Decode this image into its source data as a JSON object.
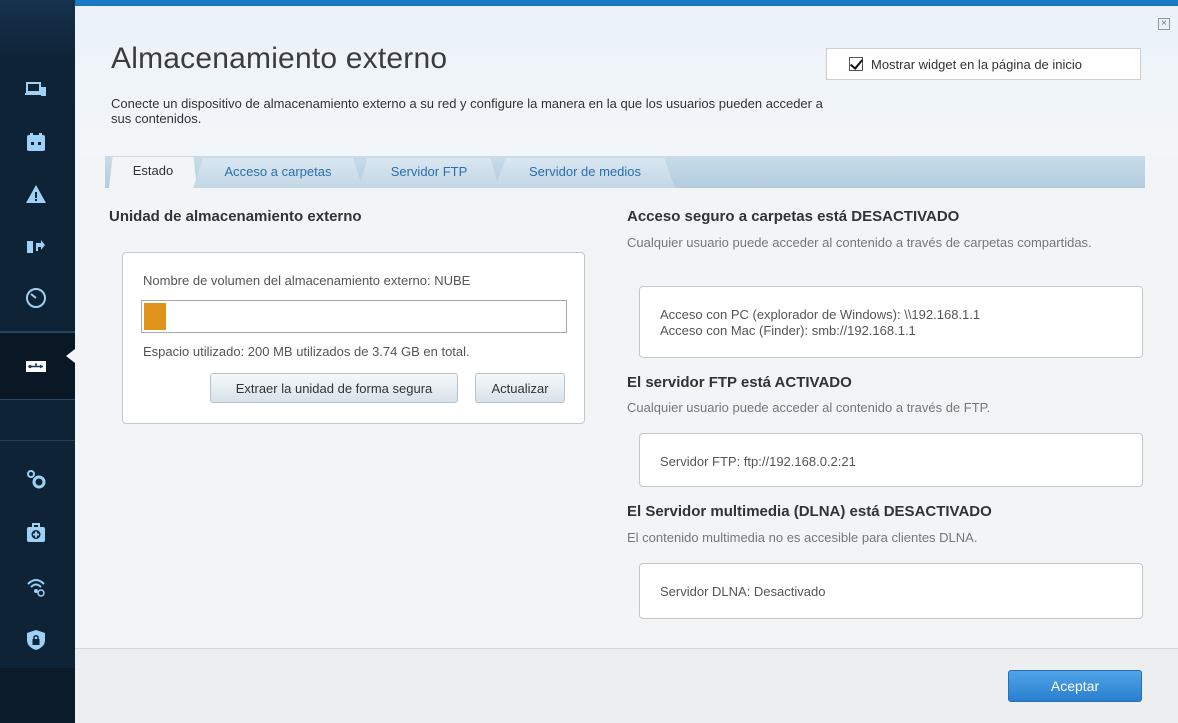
{
  "window": {
    "close_glyph": "×"
  },
  "header": {
    "title": "Almacenamiento externo",
    "description": "Conecte un dispositivo de almacenamiento externo a su red y configure la manera en la que los usuarios pueden acceder a sus contenidos.",
    "widget_checkbox_label": "Mostrar widget en la página de inicio",
    "widget_checked": true
  },
  "tabs": [
    {
      "label": "Estado",
      "active": true
    },
    {
      "label": "Acceso a carpetas",
      "active": false
    },
    {
      "label": "Servidor FTP",
      "active": false
    },
    {
      "label": "Servidor de medios",
      "active": false
    }
  ],
  "left_panel": {
    "section_title": "Unidad de almacenamiento externo",
    "volume_label": "Nombre de volumen del almacenamiento externo: NUBE",
    "usage_fraction": 0.052,
    "usage_color": "#e0931a",
    "used_label": "Espacio utilizado: 200 MB utilizados de 3.74 GB en total.",
    "eject_button": "Extraer la unidad de forma segura",
    "refresh_button": "Actualizar"
  },
  "right_panel": {
    "folder_access": {
      "title": "Acceso seguro a carpetas está DESACTIVADO",
      "subtitle": "Cualquier usuario puede acceder al contenido a través de carpetas compartidas.",
      "line1": "Acceso con PC (explorador de Windows): \\\\192.168.1.1",
      "line2": "Acceso con Mac (Finder): smb://192.168.1.1"
    },
    "ftp": {
      "title": "El servidor FTP está ACTIVADO",
      "subtitle": "Cualquier usuario puede acceder al contenido a través de FTP.",
      "line1": "Servidor FTP: ftp://192.168.0.2:21"
    },
    "dlna": {
      "title": "El Servidor multimedia (DLNA) está DESACTIVADO",
      "subtitle": "El contenido multimedia no es accesible para clientes DLNA.",
      "line1": "Servidor DLNA: Desactivado"
    }
  },
  "footer": {
    "ok_button": "Aceptar"
  },
  "sidebar": {
    "icons": [
      "devices-icon",
      "parental-controls-icon",
      "guest-access-icon",
      "media-prioritization-icon",
      "speed-test-icon",
      "usb-storage-icon",
      "connectivity-settings-icon",
      "troubleshooting-icon",
      "wireless-icon",
      "security-icon"
    ],
    "active": "usb-storage-icon"
  },
  "colors": {
    "accent": "#1b78c6",
    "sidebar": "#0e2336",
    "usage_bar": "#e0931a",
    "ok_button": "#2a7fd0"
  }
}
